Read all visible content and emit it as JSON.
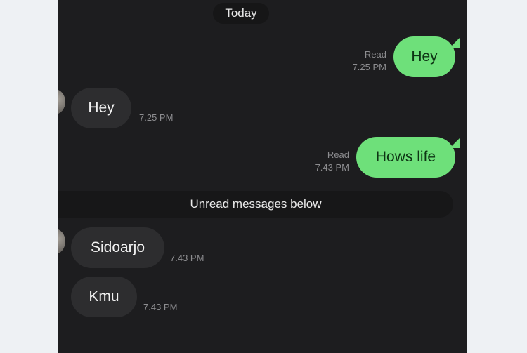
{
  "chat": {
    "date_separator": "Today",
    "messages": [
      {
        "direction": "outgoing",
        "text": "Hey",
        "status": "Read",
        "time": "7.25 PM"
      },
      {
        "direction": "incoming",
        "text": "Hey",
        "time": "7.25 PM"
      },
      {
        "direction": "outgoing",
        "text": "Hows life",
        "status": "Read",
        "time": "7.43 PM"
      },
      {
        "direction": "incoming",
        "text": "Sidoarjo",
        "time": "7.43 PM"
      },
      {
        "direction": "incoming",
        "text": "Kmu",
        "time": "7.43 PM"
      }
    ],
    "unread_divider": "Unread messages below"
  },
  "colors": {
    "outgoing_bubble": "#6ee07a",
    "incoming_bubble": "#2d2d2f",
    "background": "#1d1d1f"
  }
}
